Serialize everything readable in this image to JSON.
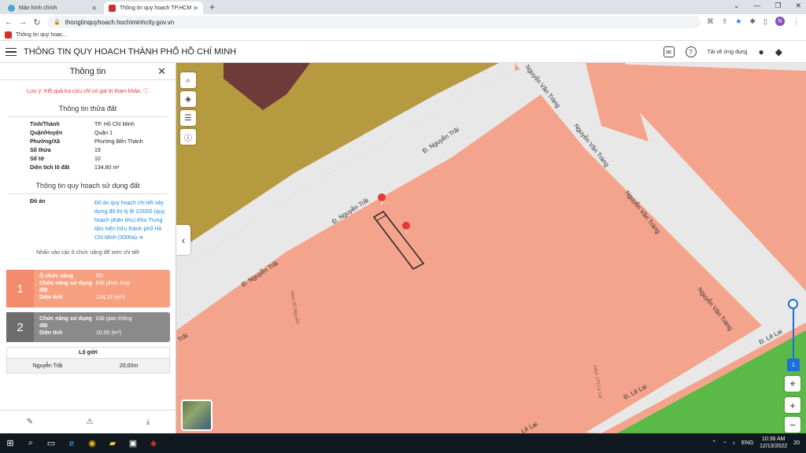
{
  "browser": {
    "tabs": [
      {
        "label": "Màn hình chính"
      },
      {
        "label": "Thông tin quy hoạch TP.HCM"
      }
    ],
    "url": "thongtinquyhoach.hochiminhcity.gov.vn",
    "bookmark": "Thông tin quy hoạc...",
    "profile_initial": "N"
  },
  "header": {
    "title": "THÔNG TIN QUY HOẠCH THÀNH PHỐ HỒ CHÍ MINH",
    "download_app": "Tải về ứng dụng"
  },
  "panel": {
    "title": "Thông tin",
    "note": "Lưu ý: Kết quả tra cứu chỉ có giá trị tham khảo.",
    "land_section": "Thông tin thửa đất",
    "land_info": [
      {
        "k": "Tỉnh/Thành",
        "v": "TP. Hồ Chí Minh"
      },
      {
        "k": "Quận/Huyện",
        "v": "Quận 1"
      },
      {
        "k": "Phường/Xã",
        "v": "Phường Bến Thành"
      },
      {
        "k": "Số thửa",
        "v": "19"
      },
      {
        "k": "Số tờ",
        "v": "10"
      },
      {
        "k": "Diện tích lô đất",
        "v": "134,80 m²"
      }
    ],
    "plan_section": "Thông tin quy hoạch sử dụng đất",
    "plan_label": "Đồ án",
    "plan_link": "Đồ án quy hoạch chi tiết xây dựng đô thị tỷ lệ 1/2000 (quy hoạch phân khu) Khu Trung tâm hiện hữu thành phố Hồ Chí Minh (930ha) ➔",
    "hint": "Nhấn vào các ô chức năng để xem chi tiết",
    "cards": [
      {
        "num": "1",
        "rows": [
          {
            "k": "Ô chức năng",
            "v": "R5"
          },
          {
            "k": "Chức năng sử dụng đất",
            "v": "Đất phức hợp"
          },
          {
            "k": "Diện tích",
            "v": "124,25 (m²)"
          }
        ]
      },
      {
        "num": "2",
        "rows": [
          {
            "k": "Chức năng sử dụng đất",
            "v": "Đất giao thông"
          },
          {
            "k": "Diện tích",
            "v": "10,55 (m²)"
          }
        ]
      }
    ],
    "setback_title": "Lộ giới",
    "setback_street": "Nguyễn Trãi",
    "setback_value": "20,00m"
  },
  "map": {
    "streets": [
      "Đ. Nguyễn Trãi",
      "Đ. Nguyễn Trãi",
      "Đ. Nguyễn Trãi",
      "Trãi",
      "Nguyễn Văn Tráng",
      "Nguyễn Văn Tráng",
      "Nguyễn Văn Tráng",
      "Nguyễn Văn Tráng",
      "Đ. Lê Lai",
      "Đ. Lê Lai",
      "Lê Lai",
      "Hẻm 55 Nguyễn",
      "Hẻm 170 Lê Lai"
    ],
    "markers": [
      "2",
      "1"
    ],
    "zoom_level": "1",
    "colors": {
      "residential": "#f4a48c",
      "commercial": "#b59a3f",
      "dark": "#6e3a3a",
      "road": "#e8e8e8",
      "green": "#5bb948"
    }
  },
  "taskbar": {
    "time": "10:36 AM",
    "date": "12/13/2022",
    "lang": "ENG",
    "notif": "20"
  }
}
